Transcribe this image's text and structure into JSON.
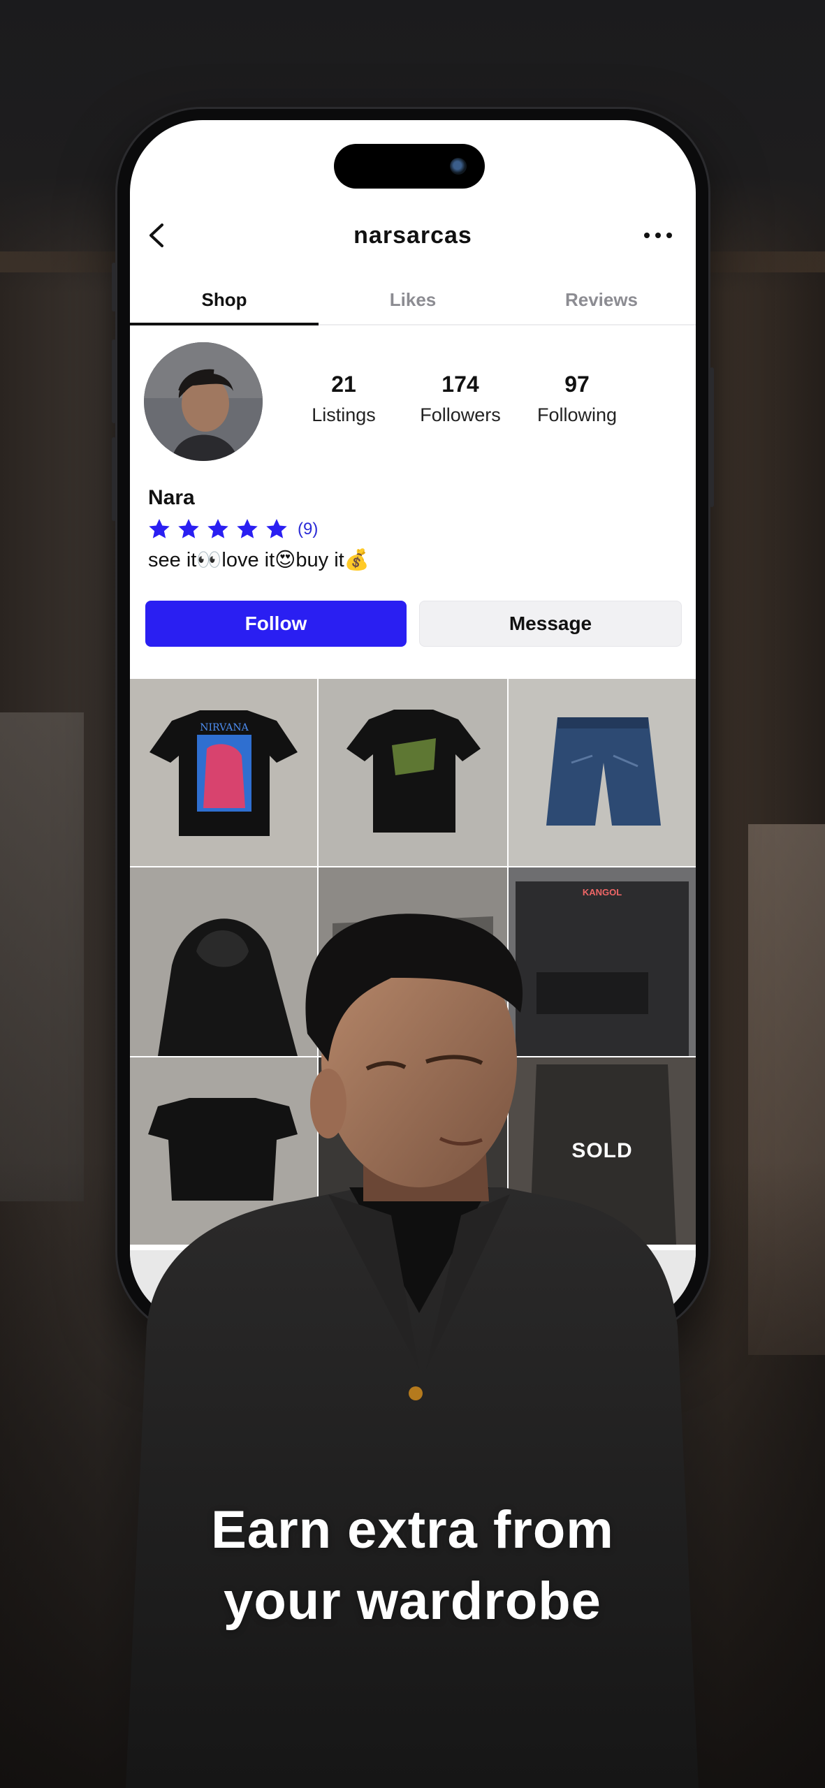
{
  "profile": {
    "username": "narsarcas",
    "name": "Nara",
    "rating_count": "(9)",
    "bio": "see it👀love it😍buy it💰"
  },
  "tabs": [
    {
      "label": "Shop"
    },
    {
      "label": "Likes"
    },
    {
      "label": "Reviews"
    }
  ],
  "stats": [
    {
      "value": "21",
      "label": "Listings"
    },
    {
      "value": "174",
      "label": "Followers"
    },
    {
      "value": "97",
      "label": "Following"
    }
  ],
  "buttons": {
    "follow": "Follow",
    "message": "Message"
  },
  "grid": {
    "sold_label": "SOLD",
    "item1_print": "NIRVANA",
    "item6_brand": "KANGOL"
  },
  "colors": {
    "accent": "#2a1ff2",
    "star": "#2a1ff2"
  },
  "rating_stars": 5,
  "promo": {
    "line1": "Earn extra from",
    "line2": "your wardrobe"
  }
}
